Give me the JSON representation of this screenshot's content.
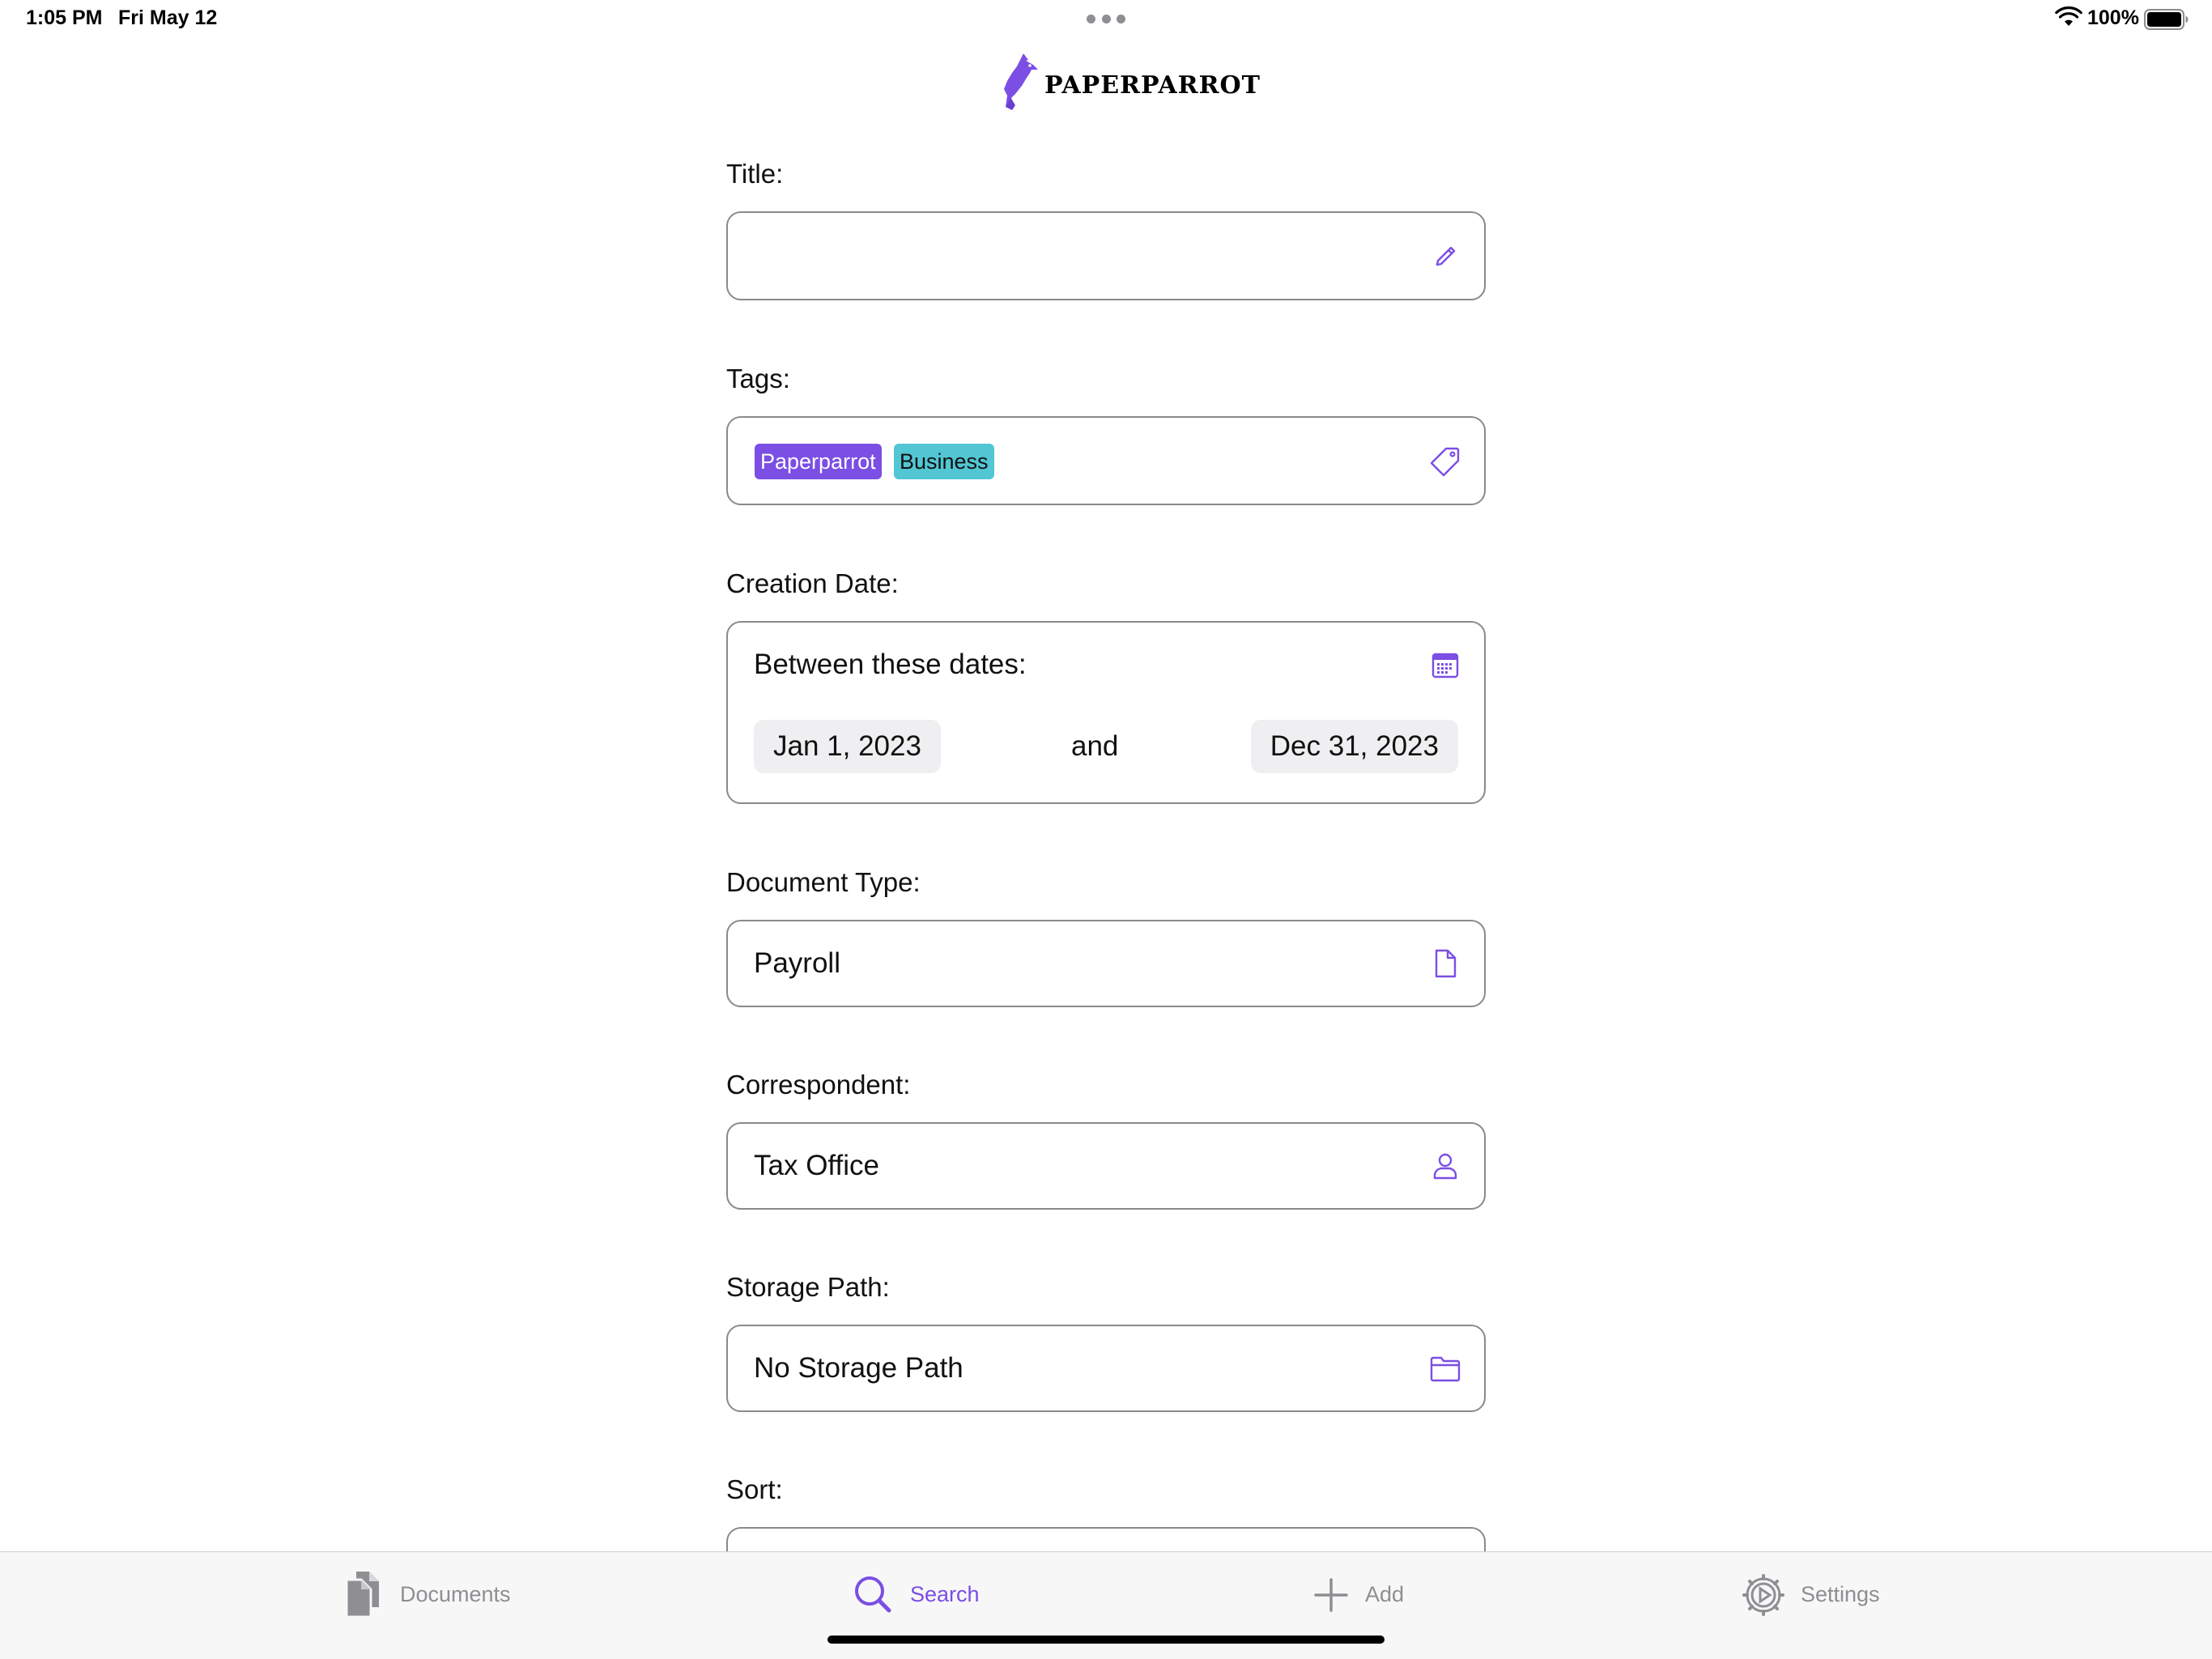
{
  "status_bar": {
    "time": "1:05 PM",
    "date": "Fri May 12",
    "battery": "100%"
  },
  "app": {
    "logo_text": "PAPERPARROT",
    "accent_color": "#7b4ee4"
  },
  "form": {
    "title": {
      "label": "Title:",
      "value": "",
      "icon": "pencil-icon"
    },
    "tags": {
      "label": "Tags:",
      "items": [
        {
          "label": "Paperparrot",
          "color": "#7b4ee4"
        },
        {
          "label": "Business",
          "color": "#52c6d3"
        }
      ],
      "icon": "tag-icon"
    },
    "creation_date": {
      "label": "Creation Date:",
      "mode": "Between these dates:",
      "start": "Jan 1, 2023",
      "conjunction": "and",
      "end": "Dec 31, 2023",
      "icon": "calendar-icon"
    },
    "document_type": {
      "label": "Document Type:",
      "value": "Payroll",
      "icon": "document-icon"
    },
    "correspondent": {
      "label": "Correspondent:",
      "value": "Tax Office",
      "icon": "person-icon"
    },
    "storage_path": {
      "label": "Storage Path:",
      "value": "No Storage Path",
      "icon": "folder-icon"
    },
    "sort": {
      "label": "Sort:"
    }
  },
  "tabbar": {
    "tabs": [
      {
        "label": "Documents",
        "icon": "documents-icon",
        "active": false
      },
      {
        "label": "Search",
        "icon": "search-icon",
        "active": true
      },
      {
        "label": "Add",
        "icon": "plus-icon",
        "active": false
      },
      {
        "label": "Settings",
        "icon": "gear-icon",
        "active": false
      }
    ]
  }
}
